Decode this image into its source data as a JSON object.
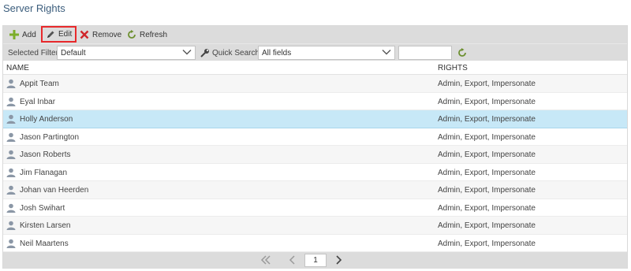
{
  "page": {
    "title": "Server Rights"
  },
  "toolbar": {
    "add_label": "Add",
    "edit_label": "Edit",
    "remove_label": "Remove",
    "refresh_label": "Refresh"
  },
  "filter": {
    "selected_filter_label": "Selected Filter:",
    "selected_filter_value": "Default",
    "quick_search_label": "Quick Search:",
    "quick_search_field": "All fields",
    "quick_search_text": ""
  },
  "table": {
    "columns": [
      "NAME",
      "RIGHTS"
    ],
    "rows": [
      {
        "name": "Appit Team",
        "rights": "Admin, Export, Impersonate",
        "selected": false
      },
      {
        "name": "Eyal Inbar",
        "rights": "Admin, Export, Impersonate",
        "selected": false
      },
      {
        "name": "Holly Anderson",
        "rights": "Admin, Export, Impersonate",
        "selected": true
      },
      {
        "name": "Jason Partington",
        "rights": "Admin, Export, Impersonate",
        "selected": false
      },
      {
        "name": "Jason Roberts",
        "rights": "Admin, Export, Impersonate",
        "selected": false
      },
      {
        "name": "Jim Flanagan",
        "rights": "Admin, Export, Impersonate",
        "selected": false
      },
      {
        "name": "Johan van Heerden",
        "rights": "Admin, Export, Impersonate",
        "selected": false
      },
      {
        "name": "Josh Swihart",
        "rights": "Admin, Export, Impersonate",
        "selected": false
      },
      {
        "name": "Kirsten Larsen",
        "rights": "Admin, Export, Impersonate",
        "selected": false
      },
      {
        "name": "Neil Maartens",
        "rights": "Admin, Export, Impersonate",
        "selected": false
      }
    ]
  },
  "pager": {
    "current_page": "1"
  },
  "icons": {
    "add": "plus-icon",
    "edit": "pencil-icon",
    "remove": "close-icon",
    "refresh": "refresh-icon",
    "quick_search": "wrench-icon",
    "user": "user-icon",
    "first_page": "double-chevron-left-icon",
    "prev_page": "chevron-left-icon",
    "next_page": "chevron-right-icon"
  },
  "colors": {
    "title": "#3b5d7c",
    "toolbar_bg": "#dcdcdc",
    "selected_row": "#c7e8f7",
    "highlight_border": "#e8292b",
    "add_green": "#7cae2a",
    "remove_red": "#d0262b"
  }
}
